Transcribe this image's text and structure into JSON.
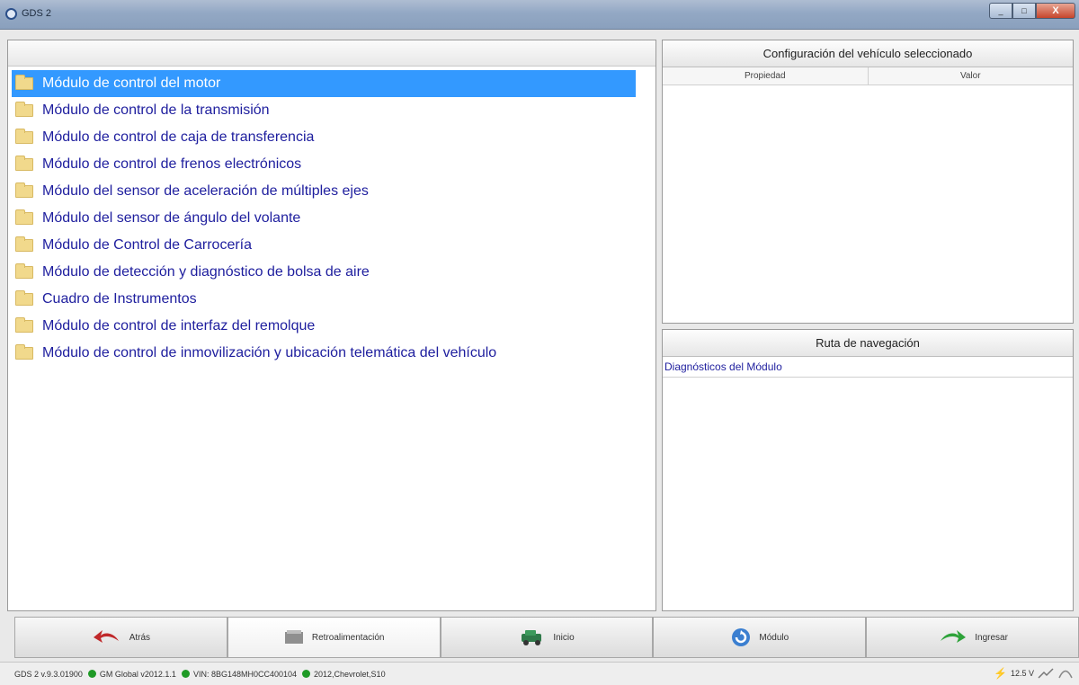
{
  "window": {
    "title": "GDS 2",
    "minimize_glyph": "_",
    "maximize_glyph": "□",
    "close_glyph": "X"
  },
  "modules": [
    {
      "label": "Módulo de control del motor",
      "selected": true
    },
    {
      "label": "Módulo de control de la transmisión"
    },
    {
      "label": "Módulo de control de caja de transferencia"
    },
    {
      "label": "Módulo de control de frenos electrónicos"
    },
    {
      "label": "Módulo del sensor de aceleración de múltiples ejes"
    },
    {
      "label": "Módulo del sensor de ángulo del volante"
    },
    {
      "label": "Módulo de Control de Carrocería"
    },
    {
      "label": "Módulo de detección y diagnóstico de bolsa de aire"
    },
    {
      "label": "Cuadro de Instrumentos"
    },
    {
      "label": "Módulo de control de interfaz del remolque"
    },
    {
      "label": "Módulo de control de inmovilización y ubicación telemática del vehículo"
    }
  ],
  "vehicle_config": {
    "title": "Configuración del vehículo seleccionado",
    "col_property": "Propiedad",
    "col_value": "Valor"
  },
  "navigation": {
    "title": "Ruta de navegación",
    "path": "Diagnósticos del Módulo"
  },
  "toolbar": {
    "back": "Atrás",
    "feedback": "Retroalimentación",
    "home": "Inicio",
    "module": "Módulo",
    "enter": "Ingresar"
  },
  "status": {
    "version": "GDS 2 v.9.3.01900",
    "global": "GM Global v2012.1.1",
    "vin": "VIN: 8BG148MH0CC400104",
    "vehicle": "2012,Chevrolet,S10",
    "voltage": "12.5 V"
  },
  "colors": {
    "selection": "#3399ff",
    "item_text": "#1e1e9e",
    "status_dot": "#1f9a26"
  }
}
